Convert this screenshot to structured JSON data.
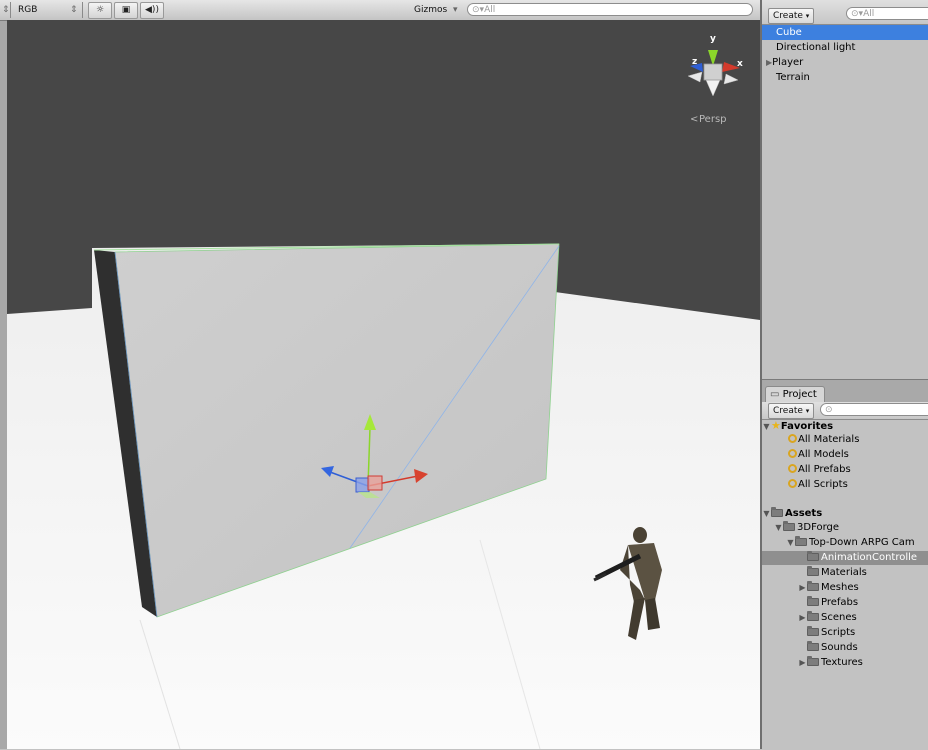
{
  "scene_toolbar": {
    "render_mode": "RGB",
    "gizmos_label": "Gizmos",
    "search_placeholder": "All",
    "lighting_icon": "sun-icon",
    "image_icon": "image-icon",
    "audio_icon": "speaker-icon"
  },
  "scene_view": {
    "camera_label": "Persp",
    "gizmo_axes": {
      "y": "y",
      "x": "x",
      "z": "z"
    }
  },
  "hierarchy": {
    "create_label": "Create",
    "search_placeholder": "All",
    "items": [
      {
        "label": "Cube",
        "selected": true,
        "expandable": false
      },
      {
        "label": "Directional light",
        "selected": false,
        "expandable": false
      },
      {
        "label": "Player",
        "selected": false,
        "expandable": true
      },
      {
        "label": "Terrain",
        "selected": false,
        "expandable": false
      }
    ]
  },
  "project": {
    "tab_label": "Project",
    "create_label": "Create",
    "favorites": {
      "label": "Favorites",
      "items": [
        "All Materials",
        "All Models",
        "All Prefabs",
        "All Scripts"
      ]
    },
    "assets": {
      "label": "Assets",
      "tree": [
        {
          "label": "3DForge",
          "depth": 1,
          "expander": "open"
        },
        {
          "label": "Top-Down ARPG Cam",
          "depth": 2,
          "expander": "open"
        },
        {
          "label": "AnimationControlle",
          "depth": 3,
          "expander": "none",
          "selected": true
        },
        {
          "label": "Materials",
          "depth": 3,
          "expander": "none"
        },
        {
          "label": "Meshes",
          "depth": 3,
          "expander": "closed"
        },
        {
          "label": "Prefabs",
          "depth": 3,
          "expander": "none"
        },
        {
          "label": "Scenes",
          "depth": 3,
          "expander": "closed"
        },
        {
          "label": "Scripts",
          "depth": 3,
          "expander": "none"
        },
        {
          "label": "Sounds",
          "depth": 3,
          "expander": "none"
        },
        {
          "label": "Textures",
          "depth": 3,
          "expander": "closed"
        }
      ]
    }
  },
  "colors": {
    "selection": "#3d80df",
    "sky": "#474747",
    "ground": "#f6f6f6",
    "axis_x": "#d33a2c",
    "axis_y": "#8bd62a",
    "axis_z": "#2f5fd6"
  }
}
